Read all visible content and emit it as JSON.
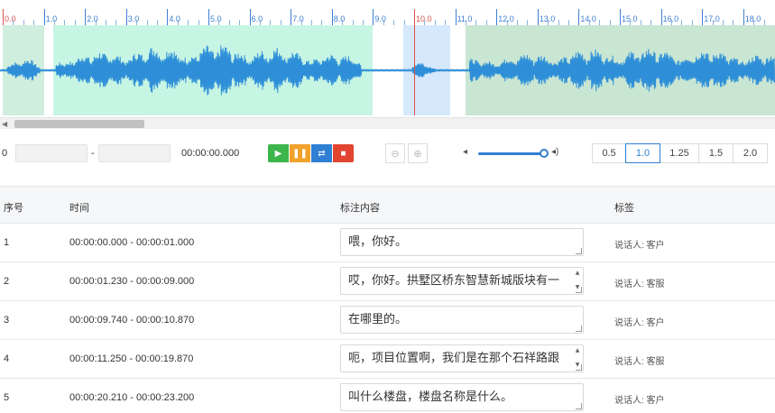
{
  "timeline": {
    "ticks": [
      "0.0",
      "1.0",
      "2.0",
      "3.0",
      "4.0",
      "5.0",
      "6.0",
      "7.0",
      "8.0",
      "9.0",
      "10.0",
      "11.0",
      "12.0",
      "13.0",
      "14.0",
      "15.0",
      "16.0",
      "17.0",
      "18.0"
    ],
    "highlight_ticks": [
      "0.0",
      "10.0"
    ],
    "colors": {
      "tick": "#3d7fd1",
      "cursor": "#d9534f",
      "wave": "#2e8fd8"
    }
  },
  "waveform": {
    "regions": [
      {
        "start": 0.0,
        "end": 1.0,
        "color": "#cfeedd"
      },
      {
        "start": 1.23,
        "end": 9.0,
        "color": "#c7f5e3"
      },
      {
        "start": 9.74,
        "end": 10.87,
        "color": "#d6e8fb"
      },
      {
        "start": 11.25,
        "end": 19.87,
        "color": "#c9e6d3"
      }
    ],
    "cursor_time": 10.0
  },
  "controls": {
    "zero_label": "0",
    "range_separator": "-",
    "start_time": "",
    "end_time": "",
    "current_time": "00:00:00.000",
    "play_icon": "play-icon",
    "pause_icon": "pause-icon",
    "loop_icon": "loop-icon",
    "stop_icon": "stop-icon",
    "zoom_out_icon": "zoom-out-icon",
    "zoom_in_icon": "zoom-in-icon",
    "volume_level": 0.92,
    "speeds": [
      "0.5",
      "1.0",
      "1.25",
      "1.5",
      "2.0"
    ],
    "active_speed": "1.0"
  },
  "table": {
    "headers": {
      "index": "序号",
      "time": "时间",
      "content": "标注内容",
      "tag": "标签"
    },
    "rows": [
      {
        "index": "1",
        "time": "00:00:00.000 - 00:00:01.000",
        "content": "喂，你好。",
        "tag": "说话人: 客户"
      },
      {
        "index": "2",
        "time": "00:00:01.230 - 00:00:09.000",
        "content": "哎，你好。拱墅区桥东智慧新城版块有一",
        "tag": "说话人: 客服"
      },
      {
        "index": "3",
        "time": "00:00:09.740 - 00:00:10.870",
        "content": "在哪里的。",
        "tag": "说话人: 客户"
      },
      {
        "index": "4",
        "time": "00:00:11.250 - 00:00:19.870",
        "content": "呃，项目位置啊，我们是在那个石祥路跟",
        "tag": "说话人: 客服"
      },
      {
        "index": "5",
        "time": "00:00:20.210 - 00:00:23.200",
        "content": "叫什么楼盘，楼盘名称是什么。",
        "tag": "说话人: 客户"
      }
    ]
  }
}
